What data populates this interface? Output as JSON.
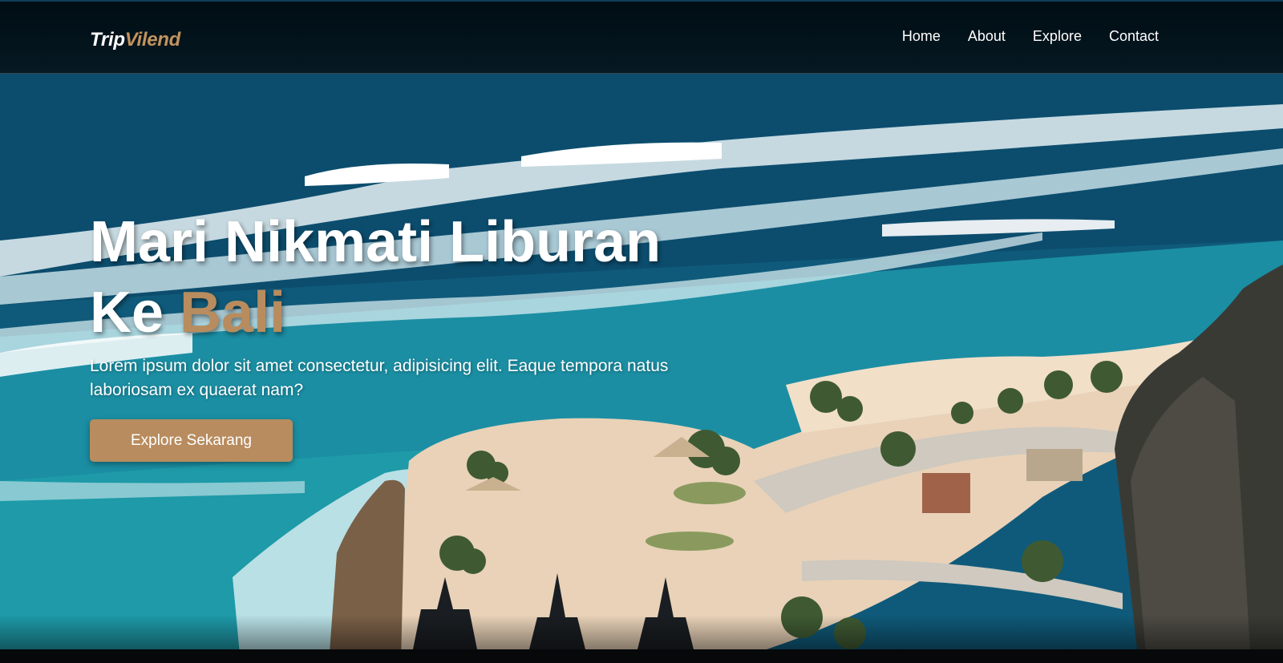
{
  "navbar": {
    "logo_main": "Trip",
    "logo_accent": "Vilend",
    "links": [
      "Home",
      "About",
      "Explore",
      "Contact"
    ]
  },
  "hero": {
    "headline_line1": "Mari Nikmati Liburan",
    "headline_line2_prefix": "Ke ",
    "headline_line2_accent": "Bali",
    "description": "Lorem ipsum dolor sit amet consectetur, adipisicing elit. Eaque tempora natus laboriosam ex quaerat nam?",
    "cta_label": "Explore Sekarang",
    "background": "beach-cliff-photo"
  },
  "colors": {
    "accent": "#b88c5e",
    "navbar_bg": "#000d14",
    "text": "#ffffff"
  }
}
